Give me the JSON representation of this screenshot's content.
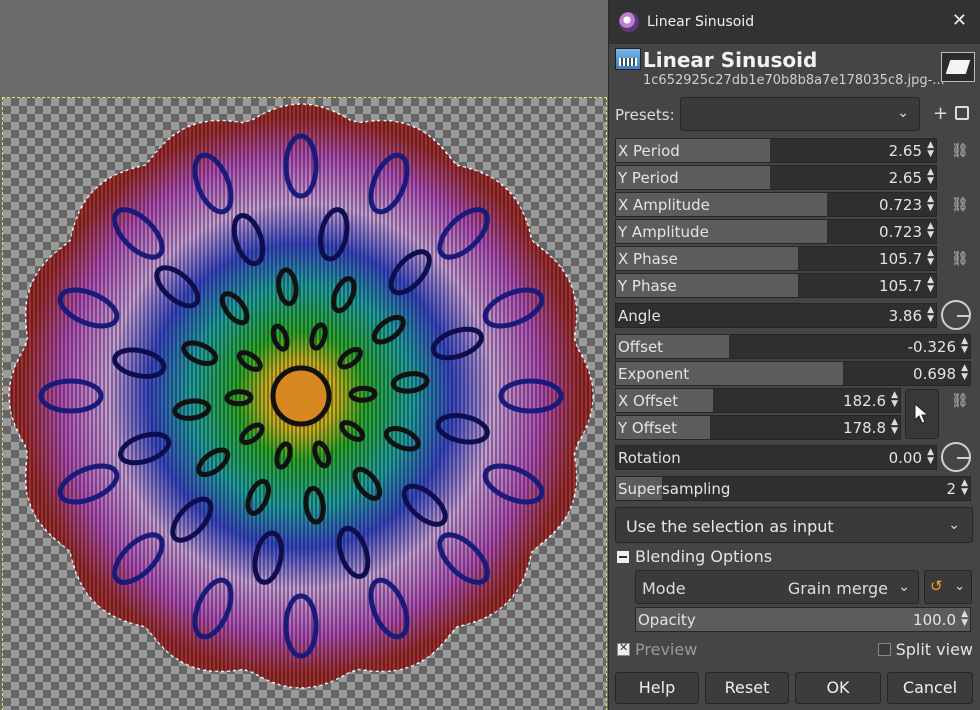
{
  "dialog": {
    "window_title": "Linear Sinusoid",
    "op_name": "Linear Sinusoid",
    "file_name": "1c652925c27db1e70b8b8a7e178035c8.jpg-...",
    "presets_label": "Presets:",
    "presets_value": "",
    "sliders": [
      {
        "label": "X Period",
        "value": "2.65",
        "fill": 0.48
      },
      {
        "label": "Y Period",
        "value": "2.65",
        "fill": 0.48
      },
      {
        "label": "X Amplitude",
        "value": "0.723",
        "fill": 0.66
      },
      {
        "label": "Y Amplitude",
        "value": "0.723",
        "fill": 0.66
      },
      {
        "label": "X Phase",
        "value": "105.7",
        "fill": 0.57
      },
      {
        "label": "Y Phase",
        "value": "105.7",
        "fill": 0.57
      },
      {
        "label": "Angle",
        "value": "3.86",
        "fill": 0.0
      },
      {
        "label": "Offset",
        "value": "-0.326",
        "fill": 0.32
      },
      {
        "label": "Exponent",
        "value": "0.698",
        "fill": 0.64
      },
      {
        "label": "X Offset",
        "value": "182.6",
        "fill": 0.34
      },
      {
        "label": "Y Offset",
        "value": "178.8",
        "fill": 0.33
      },
      {
        "label": "Rotation",
        "value": "0.00",
        "fill": 0.0
      },
      {
        "label": "Supersampling",
        "value": "2",
        "fill": 0.13
      }
    ],
    "selection_input": "Use the selection as input",
    "blending_label": "Blending Options",
    "mode_label": "Mode",
    "mode_value": "Grain merge",
    "opacity": {
      "label": "Opacity",
      "value": "100.0",
      "fill": 1.0
    },
    "preview_label": "Preview",
    "split_view_label": "Split view",
    "buttons": {
      "help": "Help",
      "reset": "Reset",
      "ok": "OK",
      "cancel": "Cancel"
    }
  },
  "colors": {
    "dialog_bg": "#454545",
    "titlebar_bg": "#323232",
    "slider_fill": "#5c5c5c",
    "selection_outline": "#e8e060"
  }
}
